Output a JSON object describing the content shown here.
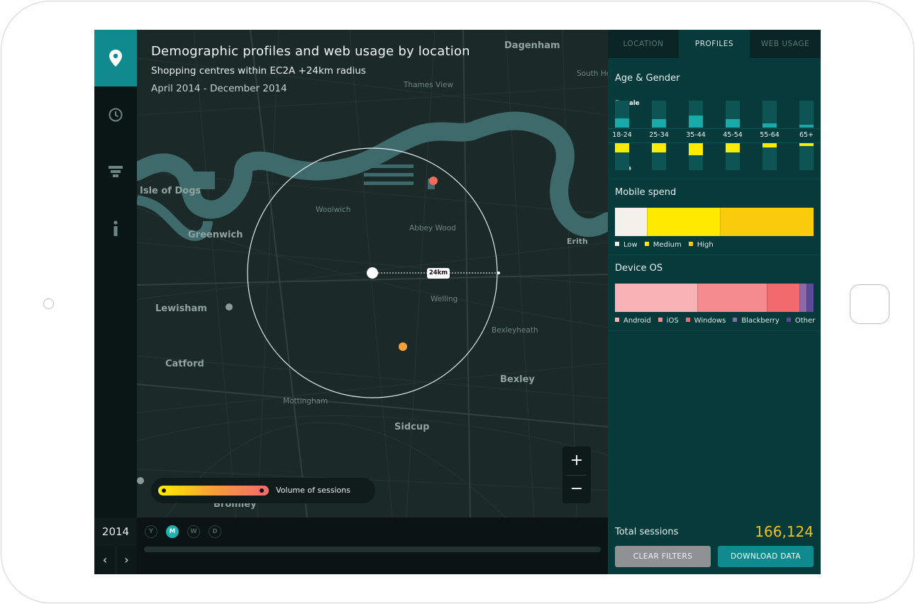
{
  "map": {
    "title": "Demographic profiles and web usage by location",
    "subtitle": "Shopping centres within EC2A +24km radius",
    "date_range": "April 2014 - December 2014",
    "radius_label": "24km",
    "places": [
      "Dagenham",
      "Isle of Dogs",
      "Greenwich",
      "Lewisham",
      "Catford",
      "Bexley",
      "Sidcup",
      "Erith",
      "Bromley",
      "Mottingham",
      "Abbey Wood",
      "Thames View",
      "Welling",
      "Woolwich",
      "Bexleyheath",
      "South Hornchurch"
    ],
    "zoom_in": "+",
    "zoom_out": "−",
    "legend_label": "Volume of sessions"
  },
  "nav": {
    "icons": [
      "location-pin-icon",
      "clock-icon",
      "filter-icon",
      "info-icon"
    ]
  },
  "timeline": {
    "year": "2014",
    "prev": "‹",
    "next": "›",
    "periods": [
      "Y",
      "M",
      "W",
      "D"
    ],
    "active_period": "M"
  },
  "panel": {
    "tabs": [
      "LOCATION",
      "PROFILES",
      "WEB USAGE"
    ],
    "active_tab": "PROFILES",
    "age_gender": {
      "title": "Age & Gender",
      "female_label": "Female",
      "male_label": "Male",
      "categories": [
        "18-24",
        "25-34",
        "35-44",
        "45-54",
        "55-64",
        "65+"
      ],
      "female": [
        0.35,
        0.32,
        0.45,
        0.32,
        0.15,
        0.1
      ],
      "male": [
        0.34,
        0.34,
        0.46,
        0.34,
        0.15,
        0.1
      ]
    },
    "mobile_spend": {
      "title": "Mobile spend",
      "segments": [
        {
          "label": "Low",
          "share": 0.16,
          "color": "#f4f1ec"
        },
        {
          "label": "Medium",
          "share": 0.37,
          "color": "#ffea00"
        },
        {
          "label": "High",
          "share": 0.47,
          "color": "#fbcb0e"
        }
      ]
    },
    "device_os": {
      "title": "Device OS",
      "segments": [
        {
          "label": "Android",
          "share": 0.415,
          "color": "#f7b3b6"
        },
        {
          "label": "iOS",
          "share": 0.35,
          "color": "#f48c8f"
        },
        {
          "label": "Windows",
          "share": 0.165,
          "color": "#f06a6e"
        },
        {
          "label": "Blackberry",
          "share": 0.035,
          "color": "#8a6aa8"
        },
        {
          "label": "Other",
          "share": 0.035,
          "color": "#5b4a9a"
        }
      ]
    },
    "total_label": "Total sessions",
    "total_value": "166,124",
    "clear_button": "CLEAR FILTERS",
    "download_button": "DOWNLOAD DATA"
  }
}
